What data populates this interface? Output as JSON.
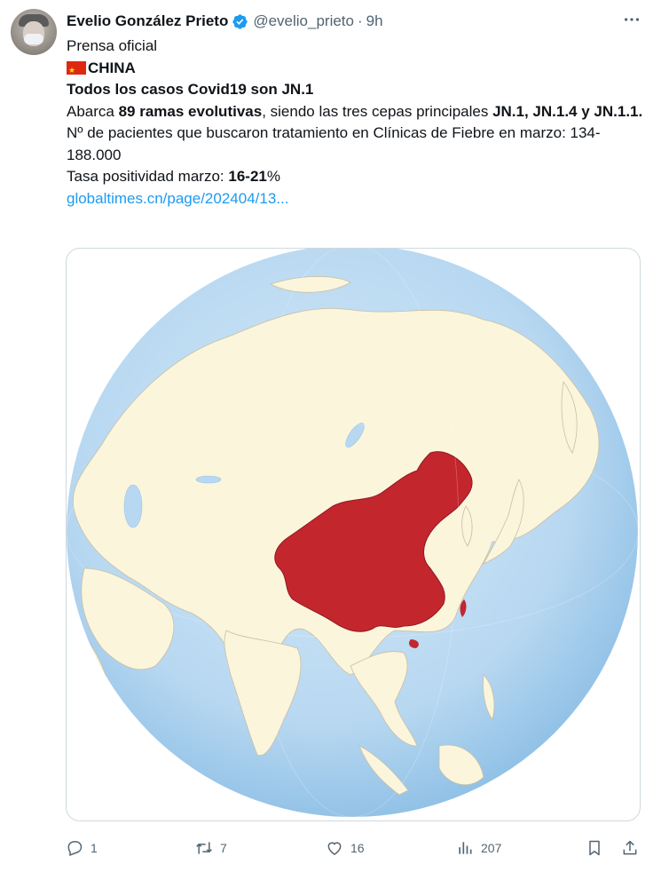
{
  "author": {
    "name": "Evelio González Prieto",
    "handle": "@evelio_prieto",
    "separator": "·",
    "time": "9h"
  },
  "content": {
    "line1": "Prensa oficial",
    "country": "CHINA",
    "headline": "Todos los casos Covid19 son JN.1",
    "p3_a": "Abarca ",
    "p3_b": "89 ramas evolutivas",
    "p3_c": ", siendo las tres cepas principales ",
    "p3_d": "JN.1, JN.1.4 y JN.1.1.",
    "p4": "Nº de pacientes que buscaron tratamiento en Clínicas de Fiebre en marzo: 134-188.000",
    "p5_a": "Tasa positividad marzo: ",
    "p5_b": "16-21",
    "p5_c": "%",
    "link": "globaltimes.cn/page/202404/13..."
  },
  "media": {
    "description_icon": "globe-map-china-highlighted",
    "ocean_color": "#b9d9f2",
    "land_color": "#fbf5dc",
    "highlight_color": "#c4262e"
  },
  "actions": {
    "replies": "1",
    "retweets": "7",
    "likes": "16",
    "views": "207"
  },
  "icons": {
    "verified": "verified-badge-icon",
    "more": "more-icon",
    "reply": "reply-icon",
    "retweet": "retweet-icon",
    "like": "heart-icon",
    "views": "views-icon",
    "bookmark": "bookmark-icon",
    "share": "share-icon"
  }
}
